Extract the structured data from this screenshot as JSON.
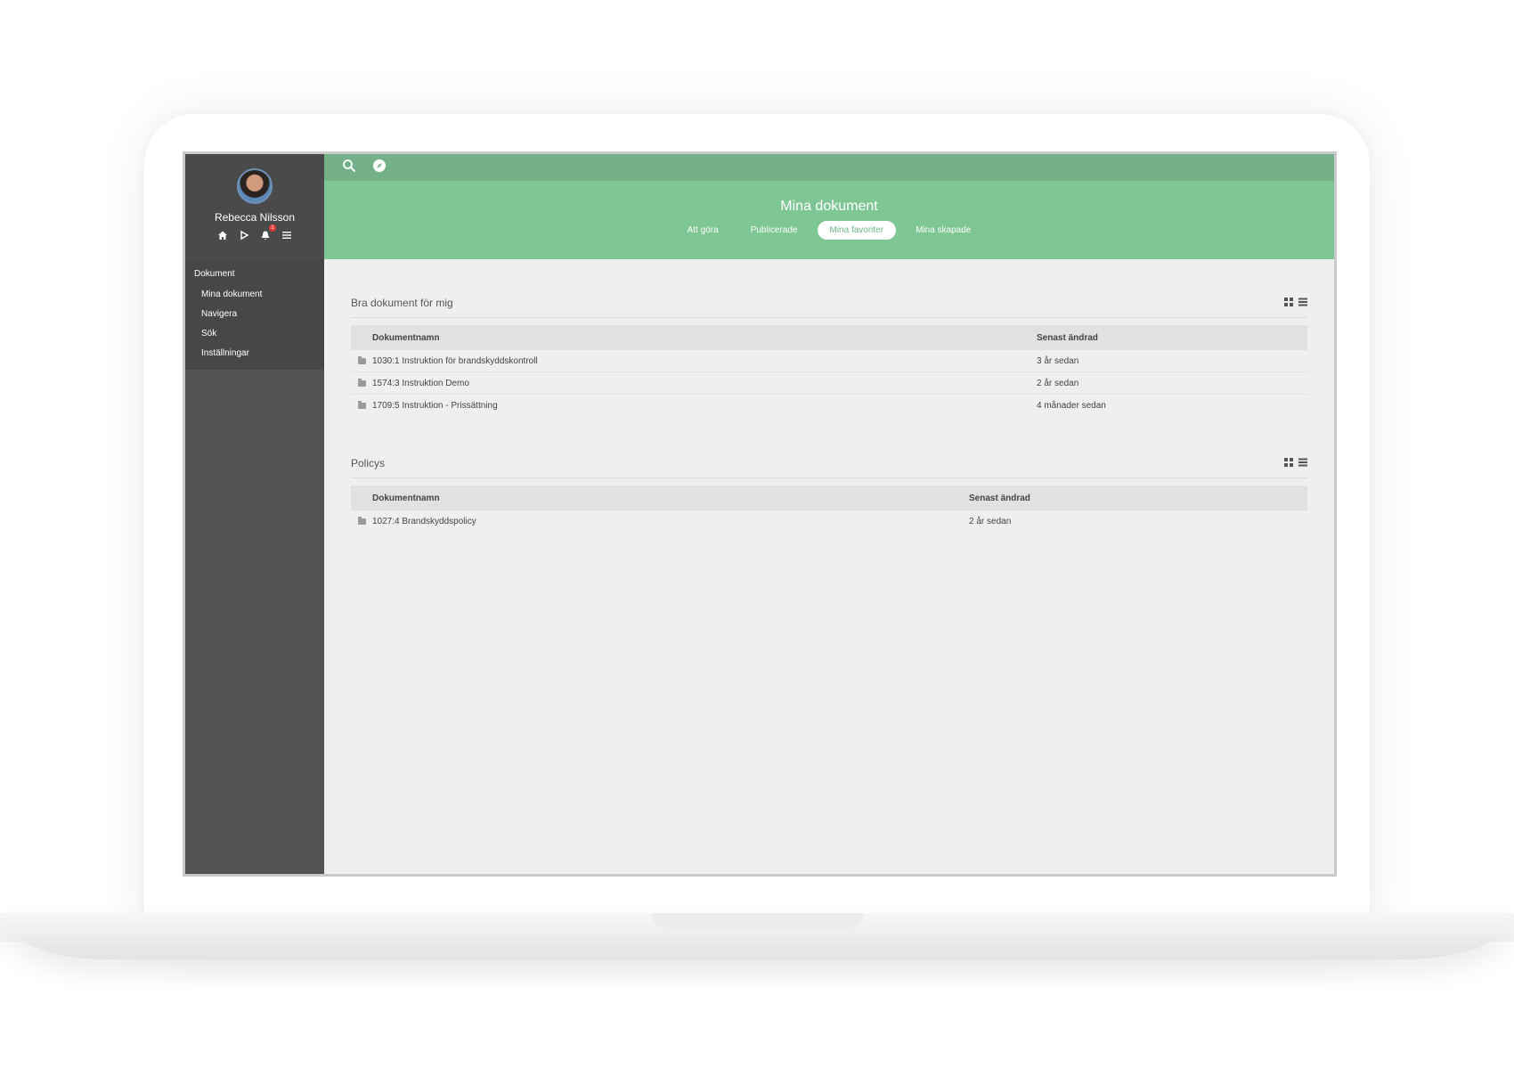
{
  "user": {
    "name": "Rebecca Nilsson",
    "notification_count": "1"
  },
  "sidebar": {
    "section_title": "Dokument",
    "items": [
      {
        "label": "Mina dokument"
      },
      {
        "label": "Navigera"
      },
      {
        "label": "Sök"
      },
      {
        "label": "Inställningar"
      }
    ]
  },
  "hero": {
    "title": "Mina dokument",
    "tabs": [
      {
        "label": "Att göra"
      },
      {
        "label": "Publicerade"
      },
      {
        "label": "Mina favoriter"
      },
      {
        "label": "Mina skapade"
      }
    ],
    "active_tab": "Mina favoriter"
  },
  "sections": [
    {
      "title": "Bra dokument för mig",
      "columns": [
        "Dokumentnamn",
        "Senast ändrad"
      ],
      "rows": [
        {
          "name": "1030:1 Instruktion för brandskyddskontroll",
          "modified": "3 år sedan"
        },
        {
          "name": "1574:3 Instruktion Demo",
          "modified": "2 år sedan"
        },
        {
          "name": "1709:5 Instruktion - Prissättning",
          "modified": "4 månader sedan"
        }
      ]
    },
    {
      "title": "Policys",
      "columns": [
        "Dokumentnamn",
        "Senast ändrad"
      ],
      "rows": [
        {
          "name": "1027:4 Brandskyddspolicy",
          "modified": "2 år sedan"
        }
      ]
    }
  ],
  "colors": {
    "topbar": "#74b088",
    "hero": "#7ec694",
    "sidebar": "#535353",
    "badge": "#e23b3b"
  }
}
